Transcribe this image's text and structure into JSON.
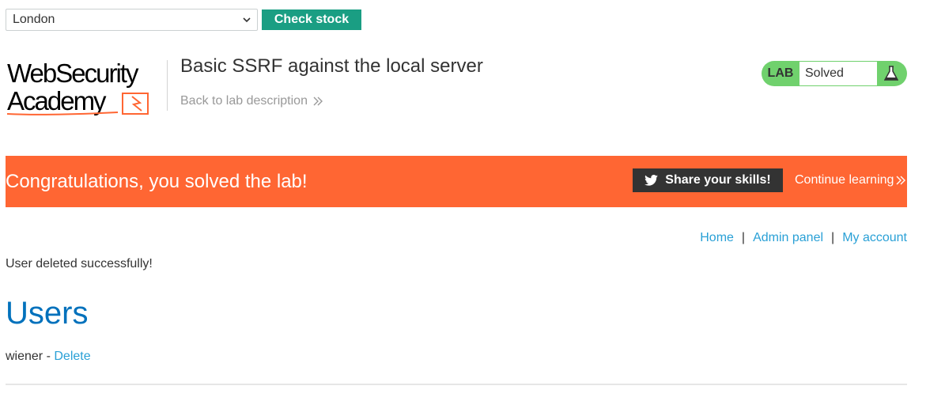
{
  "stock": {
    "store_value": "London",
    "check_label": "Check stock"
  },
  "header": {
    "logo_line1": "WebSecurity",
    "logo_line2": "Academy",
    "lab_title": "Basic SSRF against the local server",
    "back_link": "Back to lab description",
    "status_label": "LAB",
    "status_value": "Solved"
  },
  "banner": {
    "message": "Congratulations, you solved the lab!",
    "share_label": "Share your skills!",
    "continue_label": "Continue learning",
    "color": "#ff6633"
  },
  "nav": {
    "home": "Home",
    "admin": "Admin panel",
    "account": "My account",
    "separator": "|"
  },
  "content": {
    "message": "User deleted successfully!",
    "heading": "Users",
    "user_name": "wiener",
    "user_sep": " - ",
    "delete_label": "Delete"
  },
  "icons": {
    "select_arrow": "chevron-down-icon",
    "flask": "flask-icon",
    "twitter": "twitter-icon",
    "back_arrow": "double-chevron-right-icon"
  },
  "colors": {
    "accent_green": "#1a9e83",
    "status_green": "#70d16d",
    "link_blue": "#29a0d6",
    "heading_blue": "#0071bc"
  }
}
